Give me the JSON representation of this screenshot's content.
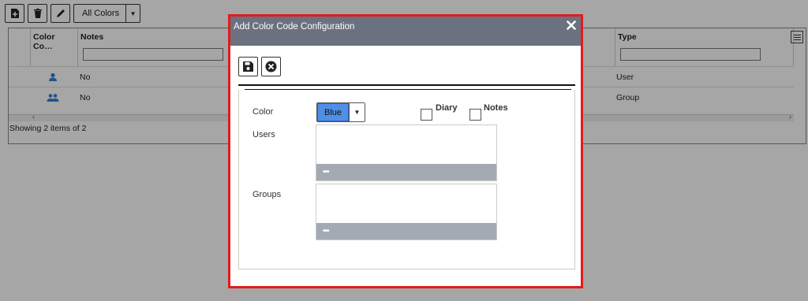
{
  "toolbar": {
    "icons": [
      "new-file-icon",
      "trash-icon",
      "pencil-icon"
    ],
    "color_filter": "All Colors"
  },
  "grid": {
    "headers": {
      "color_code": "Color Co…",
      "notes": "Notes",
      "type": "Type"
    },
    "rows": [
      {
        "icon": "user-icon",
        "notes": "No",
        "type": "User"
      },
      {
        "icon": "group-icon",
        "notes": "No",
        "type": "Group"
      }
    ],
    "footer": "Showing 2 items of 2"
  },
  "modal": {
    "title": "Add Color Code Configuration",
    "form": {
      "color_label": "Color",
      "color_value": "Blue",
      "color_value_swatch": "#4f8fe6",
      "diary_label": "Diary",
      "notes_label": "Notes",
      "users_label": "Users",
      "groups_label": "Groups",
      "users_button": "•••",
      "groups_button": "•••"
    }
  },
  "colors": {
    "modal_border": "#e21b1b",
    "modal_header": "#6b717e",
    "picker_bar": "#a4aab3",
    "user_icon": "#3a7bd5"
  }
}
